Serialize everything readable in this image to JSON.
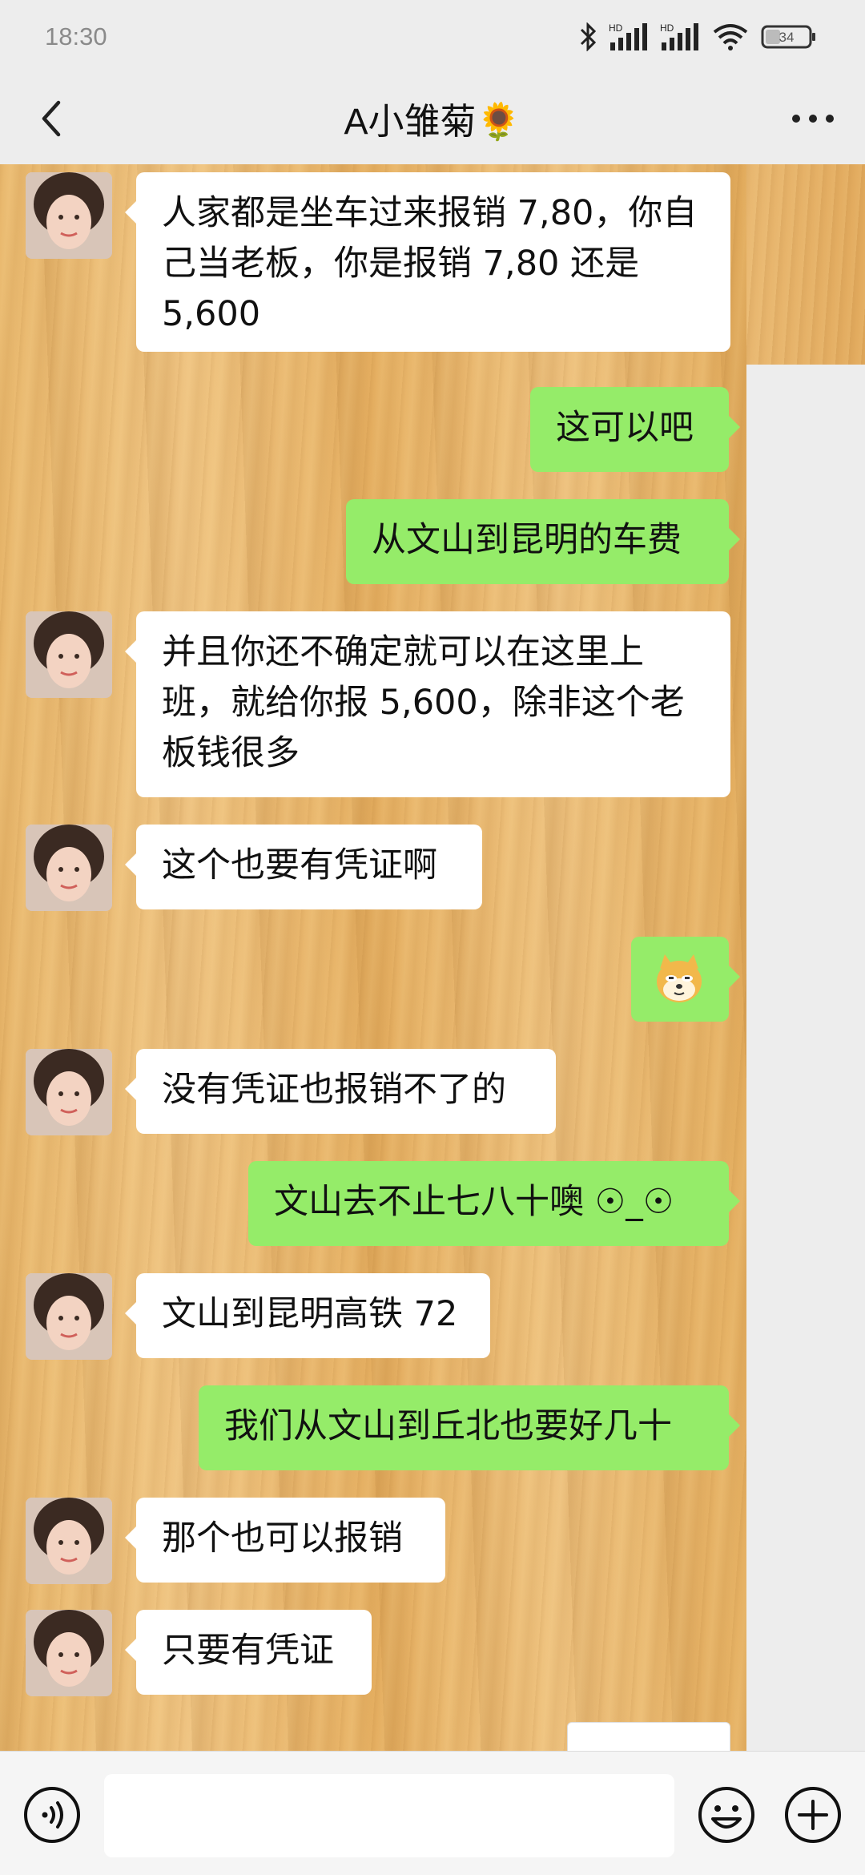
{
  "status_bar": {
    "time": "18:30",
    "battery": "34",
    "network_1": "HD",
    "network_2": "HD",
    "icons": [
      "bluetooth-icon",
      "signal-hd-icon",
      "signal-hd-icon",
      "wifi-icon",
      "battery-icon"
    ]
  },
  "header": {
    "title": "A小雏菊🌻",
    "back_icon": "chevron-left-icon",
    "more_icon": "more-dots-icon"
  },
  "messages": [
    {
      "side": "left",
      "text": "人家都是坐车过来报销 7,80，你自\n己当老板，你是报销 7,80 还是\n5,600"
    },
    {
      "side": "right",
      "text": "这可以吧"
    },
    {
      "side": "right",
      "text": "从文山到昆明的车费"
    },
    {
      "side": "left",
      "text": "并且你还不确定就可以在这里上\n班，就给你报 5,600，除非这个老\n板钱很多"
    },
    {
      "side": "left",
      "text": "这个也要有凭证啊"
    },
    {
      "side": "right",
      "sticker": "doge-emoji"
    },
    {
      "side": "left",
      "text": "没有凭证也报销不了的"
    },
    {
      "side": "right",
      "text": "文山去不止七八十噢 ☉_☉"
    },
    {
      "side": "left",
      "text": "文山到昆明高铁 72"
    },
    {
      "side": "right",
      "text": "我们从文山到丘北也要好几十"
    },
    {
      "side": "left",
      "text": "那个也可以报销"
    },
    {
      "side": "left",
      "text": "只要有凭证"
    }
  ],
  "input_bar": {
    "voice_icon": "voice-icon",
    "input_value": "",
    "emoji_icon": "emoji-icon",
    "plus_icon": "plus-icon"
  },
  "colors": {
    "sent_bubble": "#95ec69",
    "received_bubble": "#ffffff",
    "background": "#ededed"
  }
}
